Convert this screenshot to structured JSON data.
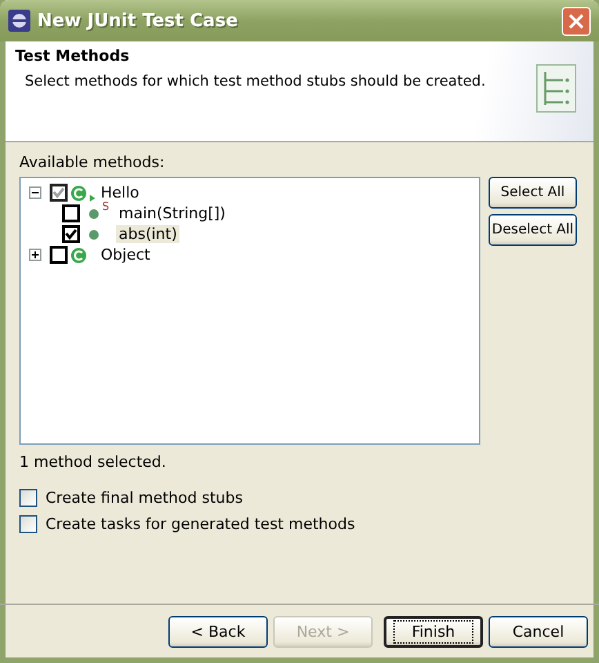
{
  "window": {
    "title": "New JUnit Test Case"
  },
  "header": {
    "title": "Test Methods",
    "description": "Select methods for which test method stubs should be created."
  },
  "tree_label": "Available methods:",
  "tree": [
    {
      "label": "Hello",
      "expanded": true,
      "checked": true,
      "grayed": true,
      "children": [
        {
          "label": "main(String[])",
          "static_mark": "S",
          "checked": false,
          "selected": false
        },
        {
          "label": "abs(int)",
          "checked": true,
          "selected": true
        }
      ]
    },
    {
      "label": "Object",
      "expanded": false,
      "checked": false,
      "grayed": false
    }
  ],
  "side_buttons": [
    "Select All",
    "Deselect All"
  ],
  "status": "1 method selected.",
  "options": [
    {
      "label": "Create final method stubs",
      "checked": false
    },
    {
      "label": "Create tasks for generated test methods",
      "checked": false
    }
  ],
  "buttons": [
    {
      "label": "< Back",
      "disabled": false,
      "default": false
    },
    {
      "label": "Next >",
      "disabled": true,
      "default": false
    },
    {
      "label": "Finish",
      "disabled": false,
      "default": true
    },
    {
      "label": "Cancel",
      "disabled": false,
      "default": false
    }
  ]
}
